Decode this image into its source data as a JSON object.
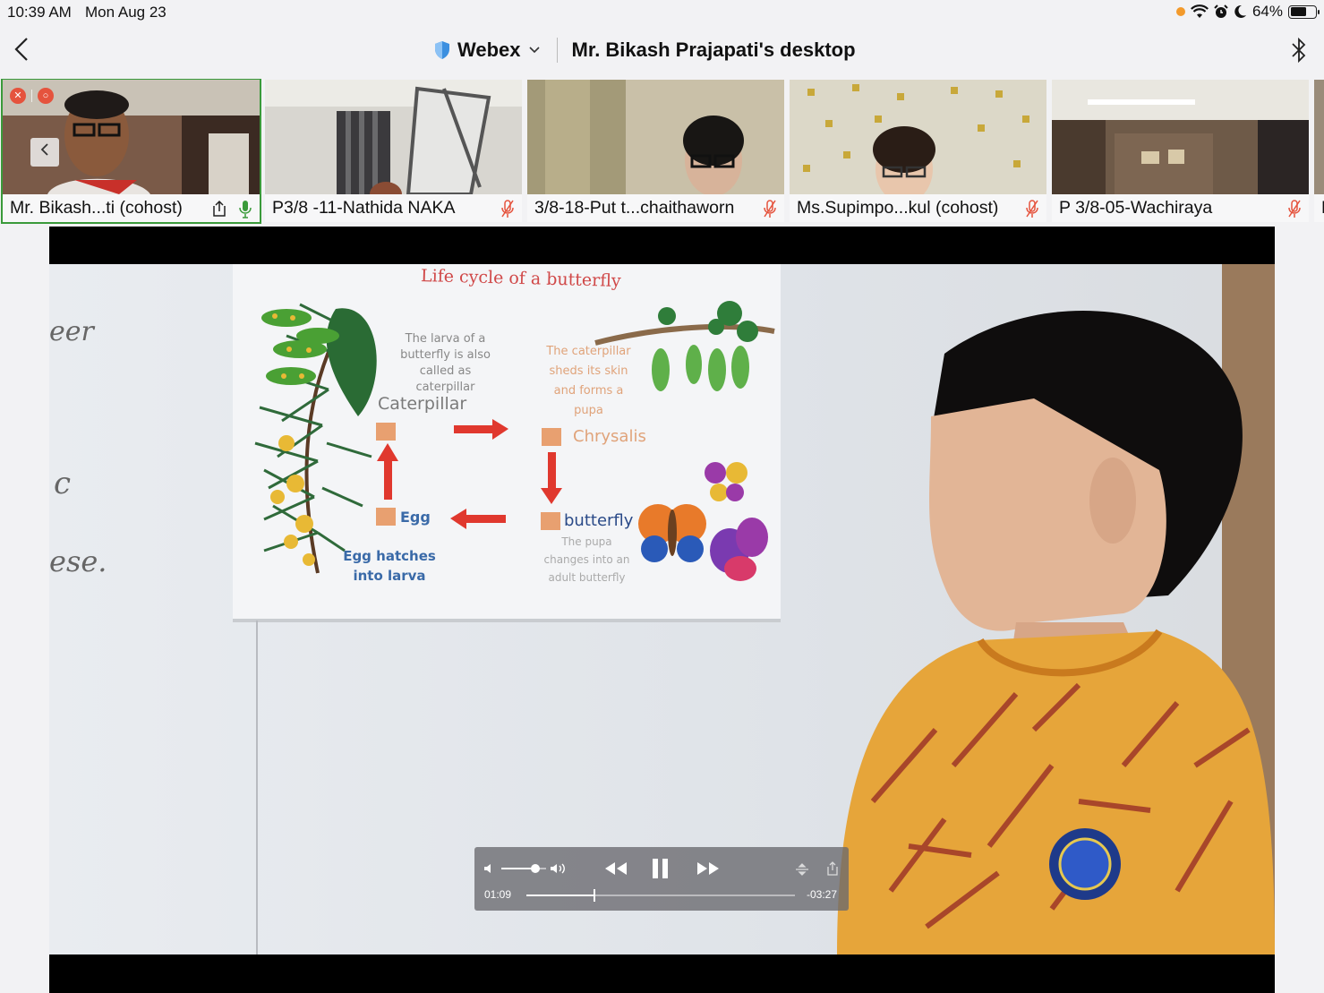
{
  "status_bar": {
    "time": "10:39 AM",
    "date": "Mon Aug 23",
    "battery_text": "64%",
    "battery_level": 0.64,
    "icons": [
      "orange-dot",
      "wifi-icon",
      "alarm-icon",
      "moon-icon",
      "battery-icon"
    ]
  },
  "nav": {
    "back_icon": "chevron-left-icon",
    "app_name": "Webex",
    "title": "Mr. Bikash Prajapati's desktop",
    "right_icon": "bluetooth-icon"
  },
  "participants": [
    {
      "name": "Mr. Bikash...ti (cohost)",
      "muted": false,
      "sharing": true
    },
    {
      "name": "P3/8 -11-Nathida NAKA",
      "muted": true
    },
    {
      "name": "3/8-18-Put t...chaithaworn",
      "muted": true
    },
    {
      "name": "Ms.Supimpo...kul (cohost)",
      "muted": true
    },
    {
      "name": "P 3/8-05-Wachiraya",
      "muted": true
    },
    {
      "name": "P",
      "muted": false
    }
  ],
  "shared_content": {
    "poster_title": "Life cycle of a butterfly",
    "larva_note": [
      "The larva of a",
      "butterfly is also",
      "called as caterpillar"
    ],
    "pupa_note": [
      "The caterpillar",
      "sheds its skin",
      "and forms a",
      "pupa"
    ],
    "stages": {
      "caterpillar": "Caterpillar",
      "chrysalis": "Chrysalis",
      "egg": "Egg",
      "butterfly": "butterfly"
    },
    "egg_note": [
      "Egg hatches",
      "into larva"
    ],
    "butterfly_note": [
      "The pupa",
      "changes into an",
      "adult butterfly"
    ],
    "whiteboard_fragments": [
      "eer",
      "c",
      "ese."
    ]
  },
  "media_controls": {
    "elapsed": "01:09",
    "remaining": "-03:27",
    "progress": 0.25,
    "volume": 0.75,
    "state": "playing"
  },
  "colors": {
    "accent_red": "#d04848",
    "muted_mic": "#e5533d",
    "active_mic": "#3a9a3a",
    "webex_shield": "#3b8fe0"
  }
}
